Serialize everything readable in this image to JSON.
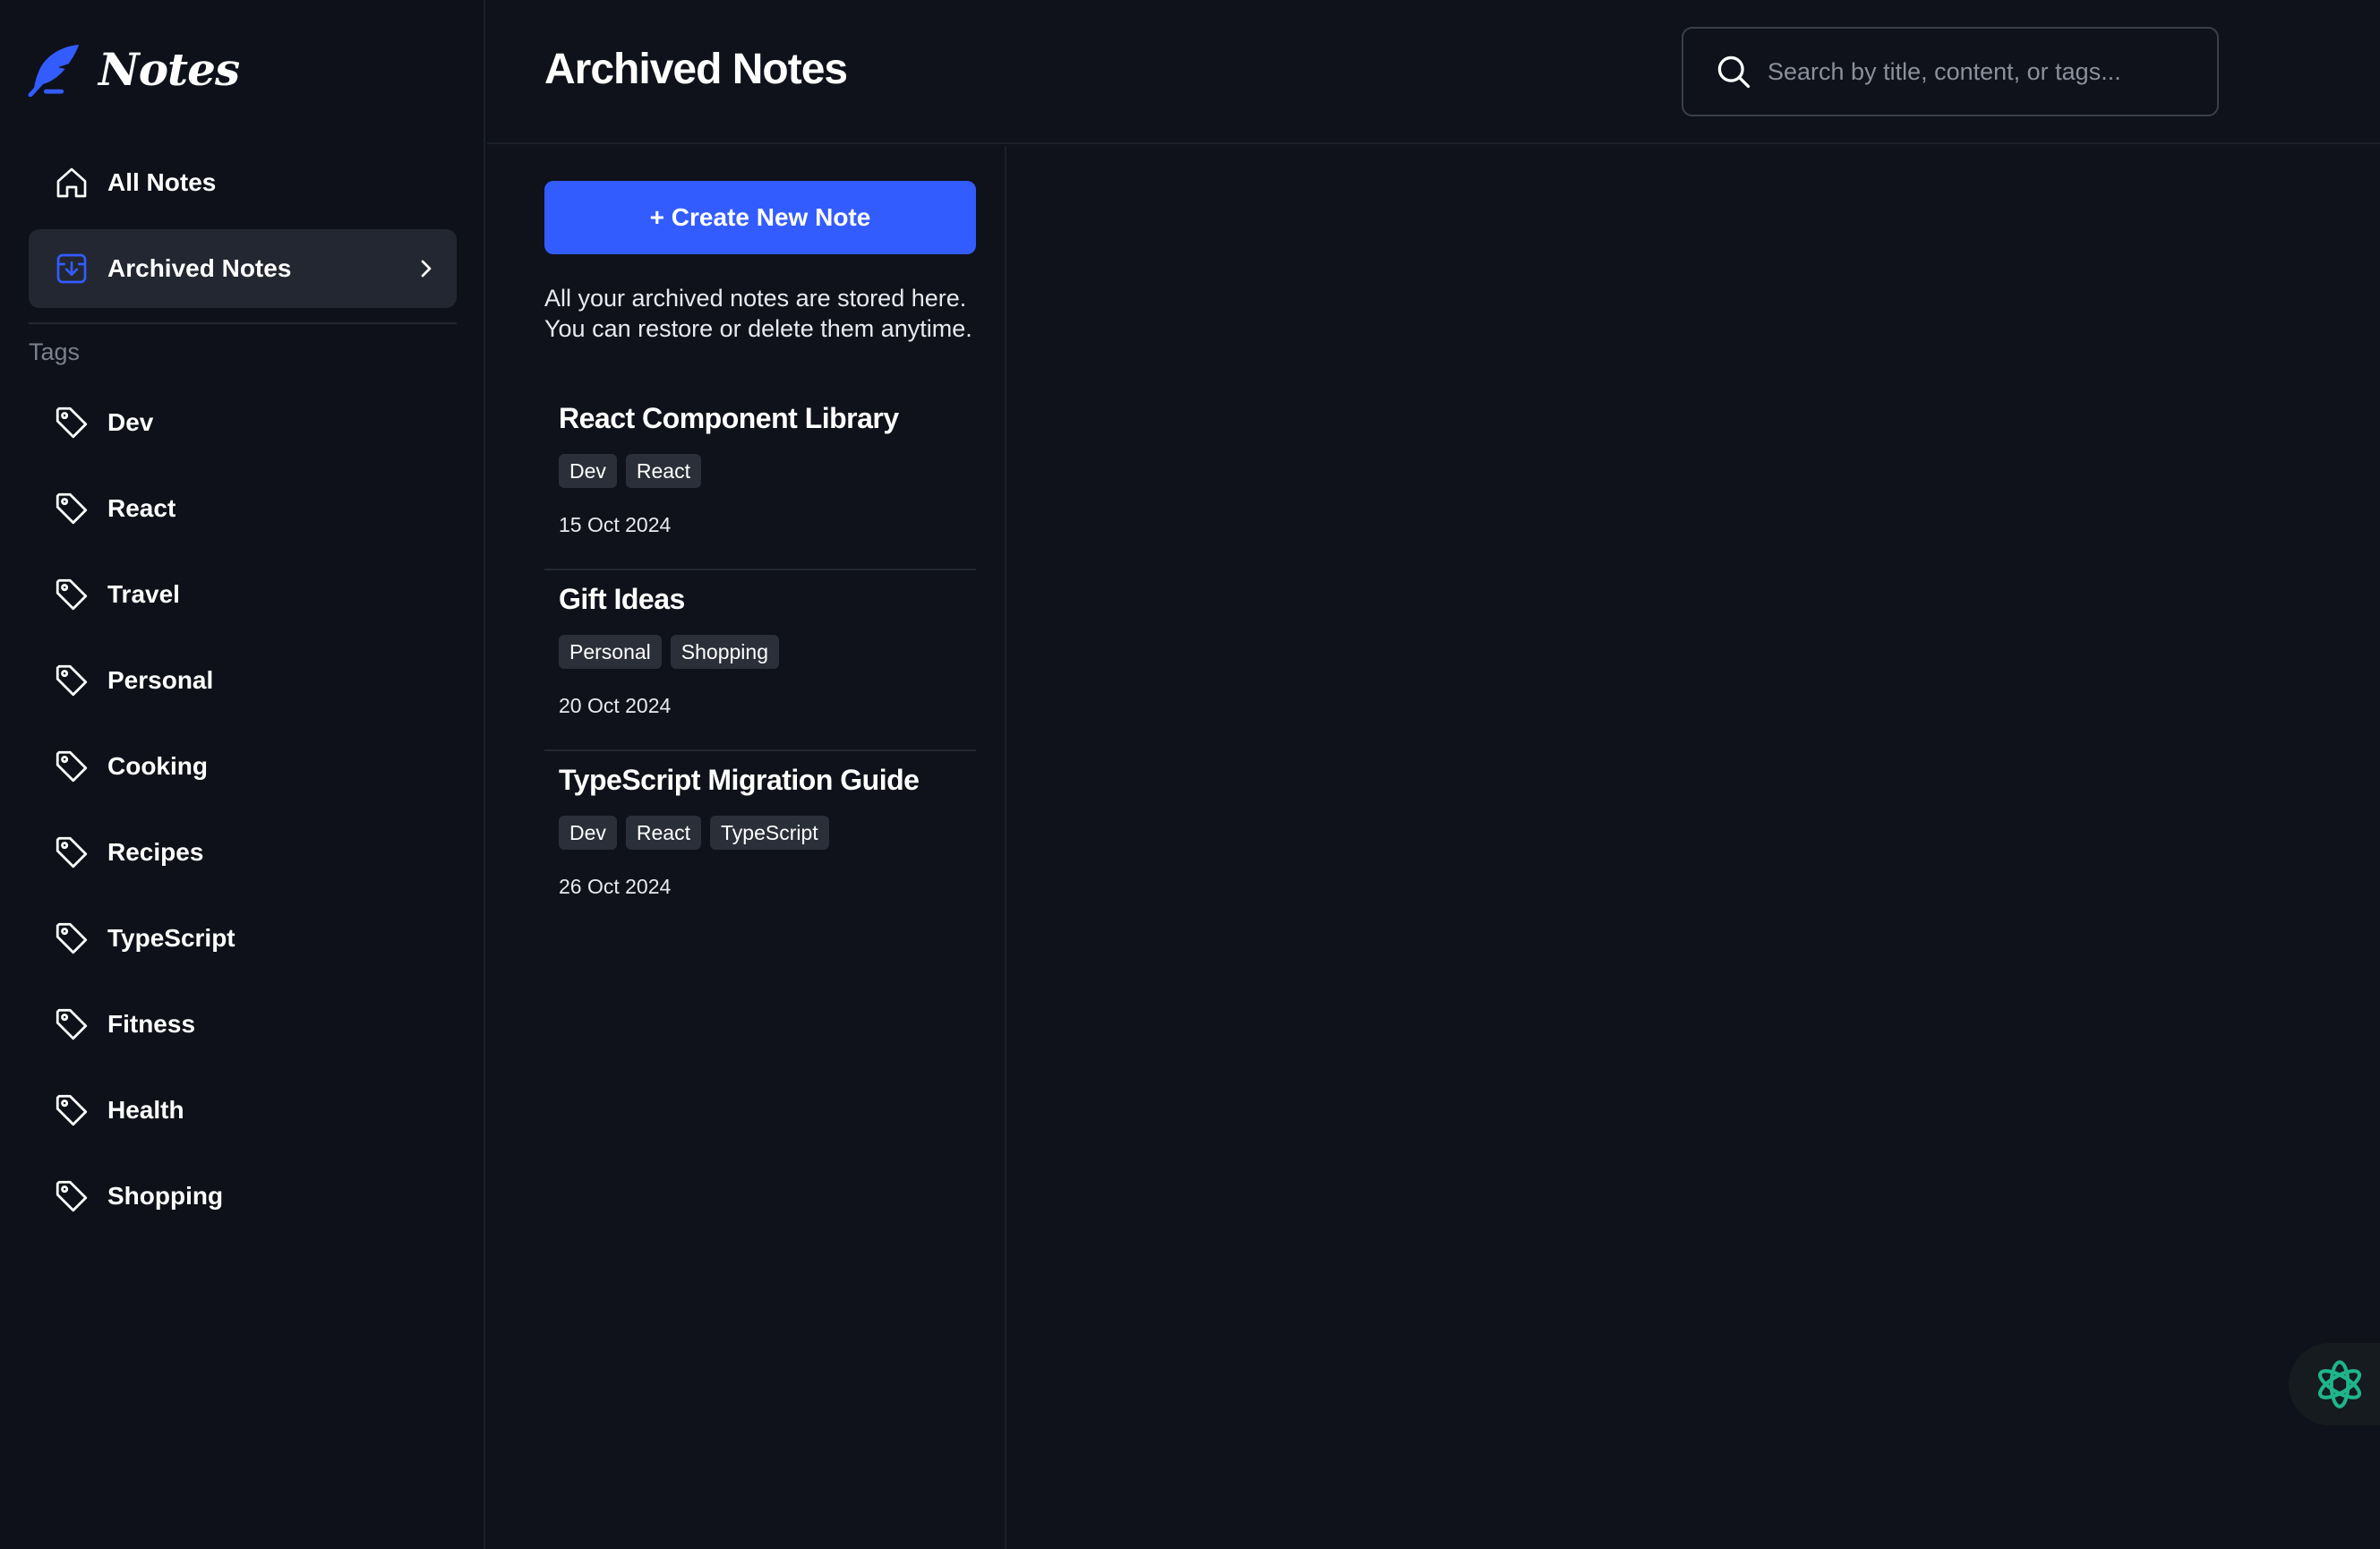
{
  "app": {
    "logo_text": "Notes",
    "accent": "#335cff"
  },
  "sidebar": {
    "nav": [
      {
        "label": "All Notes",
        "icon": "home-icon"
      },
      {
        "label": "Archived Notes",
        "icon": "archive-icon",
        "active": true
      }
    ],
    "tags_heading": "Tags",
    "tags": [
      "Dev",
      "React",
      "Travel",
      "Personal",
      "Cooking",
      "Recipes",
      "TypeScript",
      "Fitness",
      "Health",
      "Shopping"
    ]
  },
  "header": {
    "title": "Archived Notes",
    "search_placeholder": "Search by title, content, or tags..."
  },
  "list": {
    "create_label": "+ Create New Note",
    "intro": "All your archived notes are stored here. You can restore or delete them anytime.",
    "notes": [
      {
        "title": "React Component Library",
        "tags": [
          "Dev",
          "React"
        ],
        "date": "15 Oct 2024"
      },
      {
        "title": "Gift Ideas",
        "tags": [
          "Personal",
          "Shopping"
        ],
        "date": "20 Oct 2024"
      },
      {
        "title": "TypeScript Migration Guide",
        "tags": [
          "Dev",
          "React",
          "TypeScript"
        ],
        "date": "26 Oct 2024"
      }
    ]
  },
  "fab": {
    "icon": "ai-assistant-icon",
    "color": "#1fb58a"
  }
}
